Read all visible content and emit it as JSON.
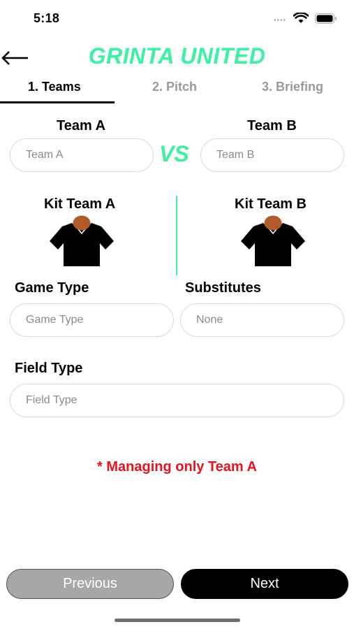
{
  "status_bar": {
    "time": "5:18",
    "signal_dots": "••••"
  },
  "header": {
    "title": "GRINTA UNITED",
    "back_icon": "arrow-left-icon",
    "accent_color": "#3df0a2"
  },
  "tabs": [
    {
      "label": "1. Teams",
      "active": true
    },
    {
      "label": "2. Pitch",
      "active": false
    },
    {
      "label": "3. Briefing",
      "active": false
    }
  ],
  "teams": {
    "team_a_label": "Team A",
    "team_a_placeholder": "Team A",
    "vs_label": "VS",
    "team_b_label": "Team B",
    "team_b_placeholder": "Team B"
  },
  "kits": {
    "kit_a_label": "Kit Team A",
    "kit_b_label": "Kit Team B",
    "kit_icon": "jersey-icon"
  },
  "game": {
    "game_type_label": "Game Type",
    "game_type_placeholder": "Game Type",
    "substitutes_label": "Substitutes",
    "substitutes_placeholder": "None",
    "field_type_label": "Field Type",
    "field_type_placeholder": "Field Type"
  },
  "note": "* Managing only Team A",
  "note_color": "#e8121e",
  "footer": {
    "previous_label": "Previous",
    "next_label": "Next"
  }
}
